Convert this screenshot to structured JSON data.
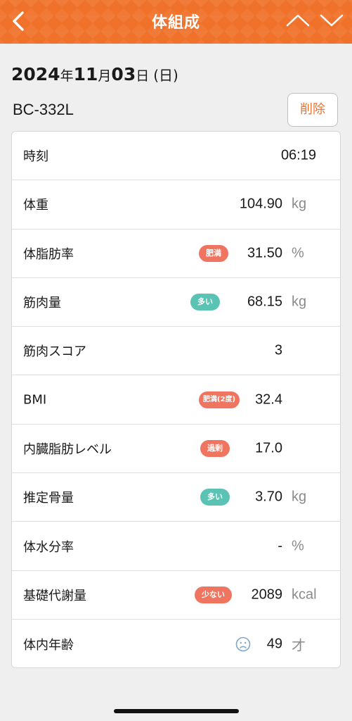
{
  "header": {
    "title": "体組成",
    "back_icon": "chevron-left-icon",
    "up_icon": "chevron-up-icon",
    "down_icon": "chevron-down-icon",
    "color": "#f0712a"
  },
  "date": {
    "year": "2024",
    "year_suffix": "年",
    "month": "11",
    "month_suffix": "月",
    "day": "03",
    "day_suffix": "日",
    "weekday": "(日)"
  },
  "device": "BC-332L",
  "delete_label": "削除",
  "rows": [
    {
      "label": "時刻",
      "value": "06:19",
      "unit": "",
      "badge": ""
    },
    {
      "label": "体重",
      "value": "104.90",
      "unit": "kg",
      "badge": ""
    },
    {
      "label": "体脂肪率",
      "value": "31.50",
      "unit": "%",
      "badge": "肥満",
      "badge_color": "red"
    },
    {
      "label": "筋肉量",
      "value": "68.15",
      "unit": "kg",
      "badge": "多い",
      "badge_color": "teal"
    },
    {
      "label": "筋肉スコア",
      "value": "3",
      "unit": "",
      "badge": ""
    },
    {
      "label": "BMI",
      "value": "32.4",
      "unit": "",
      "badge": "肥満(2度)",
      "badge_color": "red"
    },
    {
      "label": "内臓脂肪レベル",
      "value": "17.0",
      "unit": "",
      "badge": "過剰",
      "badge_color": "red"
    },
    {
      "label": "推定骨量",
      "value": "3.70",
      "unit": "kg",
      "badge": "多い",
      "badge_color": "teal"
    },
    {
      "label": "体水分率",
      "value": "-",
      "unit": "%",
      "badge": ""
    },
    {
      "label": "基礎代謝量",
      "value": "2089",
      "unit": "kcal",
      "badge": "少ない",
      "badge_color": "red"
    },
    {
      "label": "体内年齢",
      "value": "49",
      "unit": "才",
      "badge": "",
      "icon": "sad-face-icon"
    }
  ],
  "colors": {
    "accent": "#f0712a",
    "badge_red": "#ef7560",
    "badge_teal": "#5bc3b3"
  }
}
